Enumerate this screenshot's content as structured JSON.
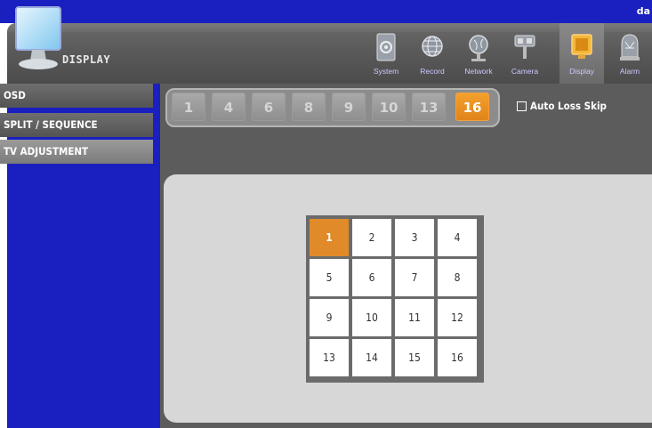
{
  "topbar": {
    "user": "da"
  },
  "header": {
    "title": "DISPLAY"
  },
  "nav": [
    {
      "label": "System",
      "icon": "system-icon"
    },
    {
      "label": "Record",
      "icon": "record-icon"
    },
    {
      "label": "Network",
      "icon": "network-icon"
    },
    {
      "label": "Camera",
      "icon": "camera-icon"
    },
    {
      "label": "Display",
      "icon": "display-icon",
      "active": true
    },
    {
      "label": "Alarm",
      "icon": "alarm-icon"
    }
  ],
  "sidebar": {
    "items": [
      {
        "label": "OSD"
      },
      {
        "label": "SPLIT / SEQUENCE"
      },
      {
        "label": "TV ADJUSTMENT"
      }
    ]
  },
  "split": {
    "options": [
      "1",
      "4",
      "6",
      "8",
      "9",
      "10",
      "13",
      "16"
    ],
    "selected": "16"
  },
  "auto_loss_skip": {
    "label": "Auto Loss Skip",
    "checked": false
  },
  "channel_grid": {
    "cells": [
      "1",
      "2",
      "3",
      "4",
      "5",
      "6",
      "7",
      "8",
      "9",
      "10",
      "11",
      "12",
      "13",
      "14",
      "15",
      "16"
    ],
    "selected": "1"
  },
  "colors": {
    "brand_blue": "#1a1fc0",
    "accent_orange": "#e8901f"
  }
}
